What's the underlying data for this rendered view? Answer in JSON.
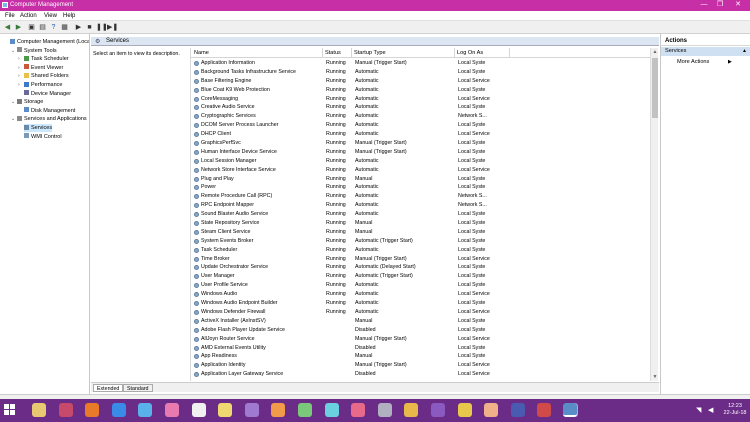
{
  "window": {
    "title": "Computer Management",
    "controls": [
      "—",
      "❐",
      "✕"
    ]
  },
  "menu": [
    "File",
    "Action",
    "View",
    "Help"
  ],
  "toolbar": [
    "◀",
    "▶",
    "▣",
    "▤",
    "?",
    "▦",
    "▶",
    "■",
    "❚❚",
    "▶❚"
  ],
  "tree": [
    {
      "label": "Computer Management (Local",
      "indent": 0,
      "icon": "computer-icon",
      "color": "#5a8cc8",
      "toggle": "",
      "selected": false
    },
    {
      "label": "System Tools",
      "indent": 1,
      "icon": "tools-icon",
      "color": "#8c8c8c",
      "toggle": "v",
      "selected": false
    },
    {
      "label": "Task Scheduler",
      "indent": 2,
      "icon": "clock-icon",
      "color": "#4a9a4a",
      "toggle": ">",
      "selected": false
    },
    {
      "label": "Event Viewer",
      "indent": 2,
      "icon": "event-icon",
      "color": "#c85a3a",
      "toggle": ">",
      "selected": false
    },
    {
      "label": "Shared Folders",
      "indent": 2,
      "icon": "folder-icon",
      "color": "#e8c04a",
      "toggle": ">",
      "selected": false
    },
    {
      "label": "Performance",
      "indent": 2,
      "icon": "performance-icon",
      "color": "#3a7ac8",
      "toggle": ">",
      "selected": false
    },
    {
      "label": "Device Manager",
      "indent": 2,
      "icon": "device-icon",
      "color": "#6a6a9a",
      "toggle": "",
      "selected": false
    },
    {
      "label": "Storage",
      "indent": 1,
      "icon": "storage-icon",
      "color": "#7a7a7a",
      "toggle": "v",
      "selected": false
    },
    {
      "label": "Disk Management",
      "indent": 2,
      "icon": "disk-icon",
      "color": "#5a8cc8",
      "toggle": "",
      "selected": false
    },
    {
      "label": "Services and Applications",
      "indent": 1,
      "icon": "services-apps-icon",
      "color": "#8a8a8a",
      "toggle": "v",
      "selected": false
    },
    {
      "label": "Services",
      "indent": 2,
      "icon": "services-icon",
      "color": "#6a8aaa",
      "toggle": "",
      "selected": true
    },
    {
      "label": "WMI Control",
      "indent": 2,
      "icon": "wmi-icon",
      "color": "#7a9aba",
      "toggle": "",
      "selected": false
    }
  ],
  "center": {
    "header": "Services",
    "description": "Select an item to view its description.",
    "columns": {
      "name": "Name",
      "status": "Status",
      "startup": "Startup Type",
      "logon": "Log On As"
    },
    "rows": [
      {
        "name": "Application Information",
        "status": "Running",
        "startup": "Manual (Trigger Start)",
        "logon": "Local Syste"
      },
      {
        "name": "Background Tasks Infrastructure Service",
        "status": "Running",
        "startup": "Automatic",
        "logon": "Local Syste"
      },
      {
        "name": "Base Filtering Engine",
        "status": "Running",
        "startup": "Automatic",
        "logon": "Local Service"
      },
      {
        "name": "Blue Coat K9 Web Protection",
        "status": "Running",
        "startup": "Automatic",
        "logon": "Local Syste"
      },
      {
        "name": "CoreMessaging",
        "status": "Running",
        "startup": "Automatic",
        "logon": "Local Service"
      },
      {
        "name": "Creative Audio Service",
        "status": "Running",
        "startup": "Automatic",
        "logon": "Local Syste"
      },
      {
        "name": "Cryptographic Services",
        "status": "Running",
        "startup": "Automatic",
        "logon": "Network S..."
      },
      {
        "name": "DCOM Server Process Launcher",
        "status": "Running",
        "startup": "Automatic",
        "logon": "Local Syste"
      },
      {
        "name": "DHCP Client",
        "status": "Running",
        "startup": "Automatic",
        "logon": "Local Service"
      },
      {
        "name": "GraphicsPerfSvc",
        "status": "Running",
        "startup": "Manual (Trigger Start)",
        "logon": "Local Syste"
      },
      {
        "name": "Human Interface Device Service",
        "status": "Running",
        "startup": "Manual (Trigger Start)",
        "logon": "Local Syste"
      },
      {
        "name": "Local Session Manager",
        "status": "Running",
        "startup": "Automatic",
        "logon": "Local Syste"
      },
      {
        "name": "Network Store Interface Service",
        "status": "Running",
        "startup": "Automatic",
        "logon": "Local Service"
      },
      {
        "name": "Plug and Play",
        "status": "Running",
        "startup": "Manual",
        "logon": "Local Syste"
      },
      {
        "name": "Power",
        "status": "Running",
        "startup": "Automatic",
        "logon": "Local Syste"
      },
      {
        "name": "Remote Procedure Call (RPC)",
        "status": "Running",
        "startup": "Automatic",
        "logon": "Network S..."
      },
      {
        "name": "RPC Endpoint Mapper",
        "status": "Running",
        "startup": "Automatic",
        "logon": "Network S..."
      },
      {
        "name": "Sound Blaster Audio Service",
        "status": "Running",
        "startup": "Automatic",
        "logon": "Local Syste"
      },
      {
        "name": "State Repository Service",
        "status": "Running",
        "startup": "Manual",
        "logon": "Local Syste"
      },
      {
        "name": "Steam Client Service",
        "status": "Running",
        "startup": "Manual",
        "logon": "Local Syste"
      },
      {
        "name": "System Events Broker",
        "status": "Running",
        "startup": "Automatic (Trigger Start)",
        "logon": "Local Syste"
      },
      {
        "name": "Task Scheduler",
        "status": "Running",
        "startup": "Automatic",
        "logon": "Local Syste"
      },
      {
        "name": "Time Broker",
        "status": "Running",
        "startup": "Manual (Trigger Start)",
        "logon": "Local Service"
      },
      {
        "name": "Update Orchestrator Service",
        "status": "Running",
        "startup": "Automatic (Delayed Start)",
        "logon": "Local Syste"
      },
      {
        "name": "User Manager",
        "status": "Running",
        "startup": "Automatic (Trigger Start)",
        "logon": "Local Syste"
      },
      {
        "name": "User Profile Service",
        "status": "Running",
        "startup": "Automatic",
        "logon": "Local Syste"
      },
      {
        "name": "Windows Audio",
        "status": "Running",
        "startup": "Automatic",
        "logon": "Local Service"
      },
      {
        "name": "Windows Audio Endpoint Builder",
        "status": "Running",
        "startup": "Automatic",
        "logon": "Local Syste"
      },
      {
        "name": "Windows Defender Firewall",
        "status": "Running",
        "startup": "Automatic",
        "logon": "Local Service"
      },
      {
        "name": "ActiveX Installer (AxInstSV)",
        "status": "",
        "startup": "Manual",
        "logon": "Local Syste"
      },
      {
        "name": "Adobe Flash Player Update Service",
        "status": "",
        "startup": "Disabled",
        "logon": "Local Syste"
      },
      {
        "name": "AllJoyn Router Service",
        "status": "",
        "startup": "Manual (Trigger Start)",
        "logon": "Local Service"
      },
      {
        "name": "AMD External Events Utility",
        "status": "",
        "startup": "Disabled",
        "logon": "Local Syste"
      },
      {
        "name": "App Readiness",
        "status": "",
        "startup": "Manual",
        "logon": "Local Syste"
      },
      {
        "name": "Application Identity",
        "status": "",
        "startup": "Manual (Trigger Start)",
        "logon": "Local Service"
      },
      {
        "name": "Application Layer Gateway Service",
        "status": "",
        "startup": "Disabled",
        "logon": "Local Service"
      }
    ],
    "tabs": [
      "Extended",
      "Standard"
    ]
  },
  "actions": {
    "header": "Actions",
    "section": "Services",
    "item": "More Actions",
    "arrow": "▶",
    "collapse": "▲"
  },
  "taskbar": {
    "time": "12:23",
    "date": "22-Jul-18",
    "apps": [
      {
        "icon": "pony-app-icon",
        "color": "#e8c870"
      },
      {
        "icon": "media-app-icon",
        "color": "#c84a6a"
      },
      {
        "icon": "firefox-icon",
        "color": "#e87a2a"
      },
      {
        "icon": "ie-icon",
        "color": "#3a8ae8"
      },
      {
        "icon": "pony-blue-icon",
        "color": "#5ab0e8"
      },
      {
        "icon": "pony-pink-icon",
        "color": "#e87ab0"
      },
      {
        "icon": "pony-white-icon",
        "color": "#f0f0f0"
      },
      {
        "icon": "pony-yellow-icon",
        "color": "#f0d870"
      },
      {
        "icon": "pony-purple-icon",
        "color": "#a07ad0"
      },
      {
        "icon": "pony-orange-icon",
        "color": "#f09a4a"
      },
      {
        "icon": "pony-green-icon",
        "color": "#7ac87a"
      },
      {
        "icon": "pony-cyan-icon",
        "color": "#6ad0e0"
      },
      {
        "icon": "pony-rose-icon",
        "color": "#e86a8a"
      },
      {
        "icon": "pony-grey-icon",
        "color": "#b0b0c0"
      },
      {
        "icon": "pony-gold-icon",
        "color": "#e8b84a"
      },
      {
        "icon": "pony-violet-icon",
        "color": "#8a5ac0"
      },
      {
        "icon": "folder-app-icon",
        "color": "#e8c84a"
      },
      {
        "icon": "pony-peach-icon",
        "color": "#f0b08a"
      },
      {
        "icon": "pony-navy-icon",
        "color": "#4a5ab0"
      },
      {
        "icon": "pony-red-icon",
        "color": "#d04a4a"
      },
      {
        "icon": "pony-lilac-icon",
        "color": "#c89ae0"
      },
      {
        "icon": "computer-management-icon",
        "color": "#5a8cc8"
      }
    ]
  },
  "colors": {
    "titlebar": "#c72fa6",
    "taskbar": "#6a2c86",
    "selection": "#cce8ff",
    "accent": "#cfe0f3"
  }
}
